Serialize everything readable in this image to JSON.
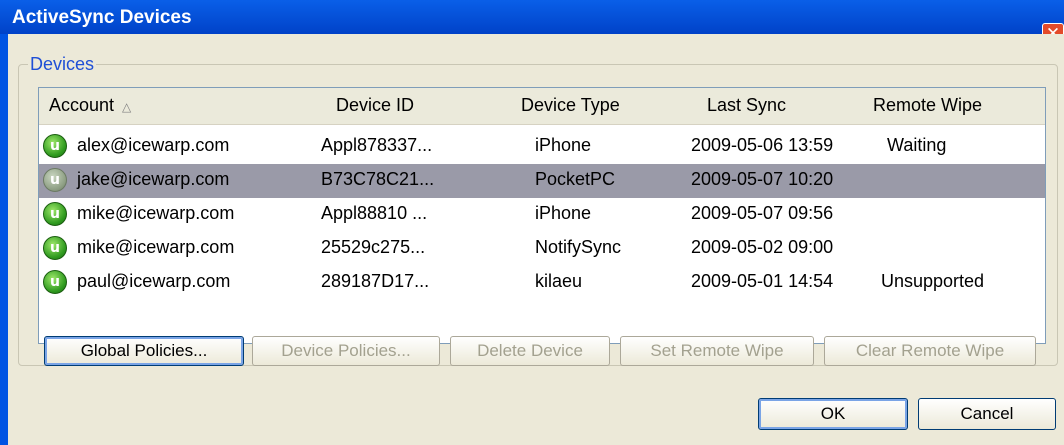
{
  "window": {
    "title": "ActiveSync Devices",
    "close_label": "✕"
  },
  "group": {
    "label": "Devices"
  },
  "list": {
    "columns": [
      "Account",
      "Device ID",
      "Device Type",
      "Last Sync",
      "Remote Wipe"
    ],
    "sort_indicator": "△",
    "rows": [
      {
        "account": "alex@icewarp.com",
        "device_id": "Appl878337...",
        "device_type": "iPhone",
        "last_sync": "2009-05-06 13:59",
        "remote_wipe": "Waiting",
        "selected": false
      },
      {
        "account": "jake@icewarp.com",
        "device_id": "B73C78C21...",
        "device_type": "PocketPC",
        "last_sync": "2009-05-07 10:20",
        "remote_wipe": "",
        "selected": true
      },
      {
        "account": "mike@icewarp.com",
        "device_id": "Appl88810 ...",
        "device_type": "iPhone",
        "last_sync": "2009-05-07 09:56",
        "remote_wipe": "",
        "selected": false
      },
      {
        "account": "mike@icewarp.com",
        "device_id": "25529c275...",
        "device_type": "NotifySync",
        "last_sync": "2009-05-02 09:00",
        "remote_wipe": "",
        "selected": false
      },
      {
        "account": "paul@icewarp.com",
        "device_id": "289187D17...",
        "device_type": "kilaeu",
        "last_sync": "2009-05-01 14:54",
        "remote_wipe": "Unsupported",
        "selected": false
      }
    ],
    "device_icon_glyph": "u"
  },
  "buttons": {
    "global_policies": "Global Policies...",
    "device_policies": "Device Policies...",
    "delete_device": "Delete Device",
    "set_remote_wipe": "Set Remote Wipe",
    "clear_remote_wipe": "Clear Remote Wipe",
    "ok": "OK",
    "cancel": "Cancel"
  },
  "colors": {
    "titlebar": "#0054e3",
    "selection": "#9a9aa8",
    "group_label": "#1f4fd6",
    "device_icon": "#2f9a1f"
  }
}
